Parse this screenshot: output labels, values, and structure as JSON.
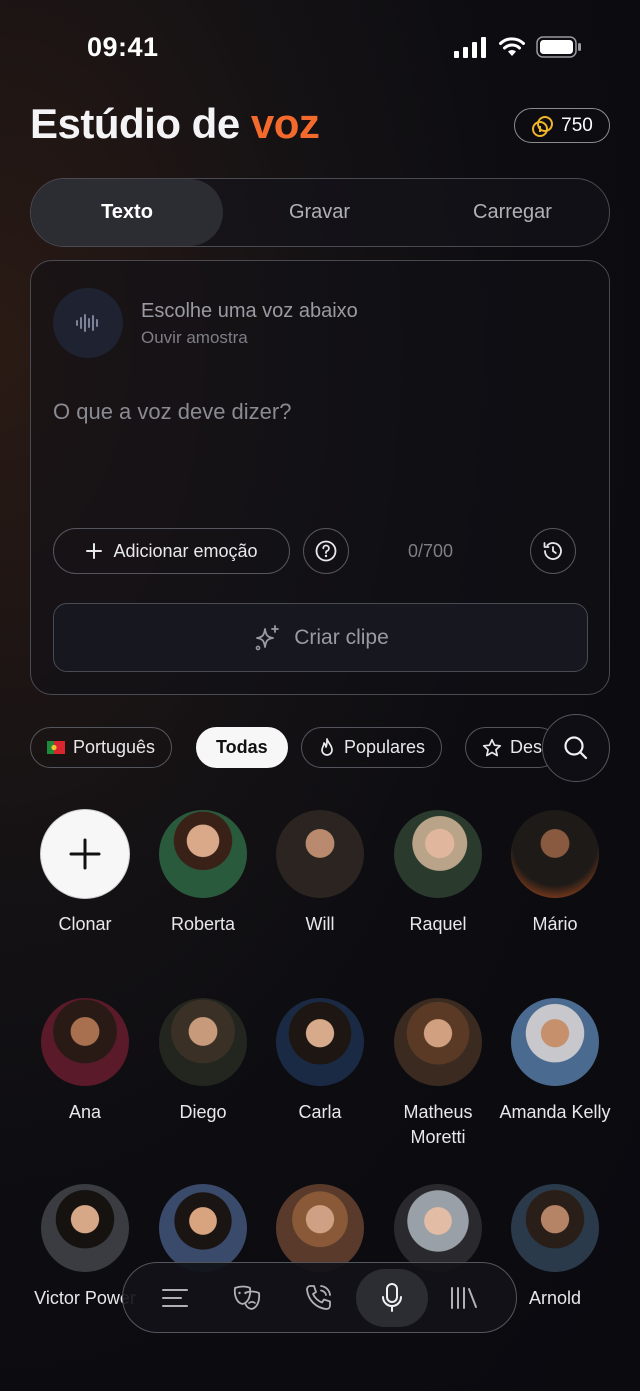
{
  "status": {
    "time": "09:41"
  },
  "header": {
    "title_part1": "Estúdio de",
    "title_part2": "voz",
    "coins": "750"
  },
  "tabs": [
    {
      "label": "Texto",
      "active": true
    },
    {
      "label": "Gravar"
    },
    {
      "label": "Carregar"
    }
  ],
  "editor": {
    "voice_title": "Escolhe uma voz abaixo",
    "voice_subtitle": "Ouvir amostra",
    "placeholder": "O que a voz deve dizer?",
    "emotion_label": "Adicionar emoção",
    "counter": "0/700",
    "create_label": "Criar clipe"
  },
  "filters": {
    "language": "Português",
    "all": "Todas",
    "popular": "Populares",
    "featured": "Des"
  },
  "voices": [
    {
      "name": "Clonar"
    },
    {
      "name": "Roberta"
    },
    {
      "name": "Will"
    },
    {
      "name": "Raquel"
    },
    {
      "name": "Mário"
    },
    {
      "name": "Ana"
    },
    {
      "name": "Diego"
    },
    {
      "name": "Carla"
    },
    {
      "name": "Matheus Moretti"
    },
    {
      "name": "Amanda Kelly"
    },
    {
      "name": "Victor Power"
    },
    {
      "name": ""
    },
    {
      "name": ""
    },
    {
      "name": ""
    },
    {
      "name": "Arnold"
    }
  ],
  "nav": [
    "menu-icon",
    "masks-icon",
    "phone-icon",
    "mic-icon",
    "library-icon"
  ],
  "colors": {
    "accent": "#f36a2c",
    "background": "#0a0a0f"
  }
}
